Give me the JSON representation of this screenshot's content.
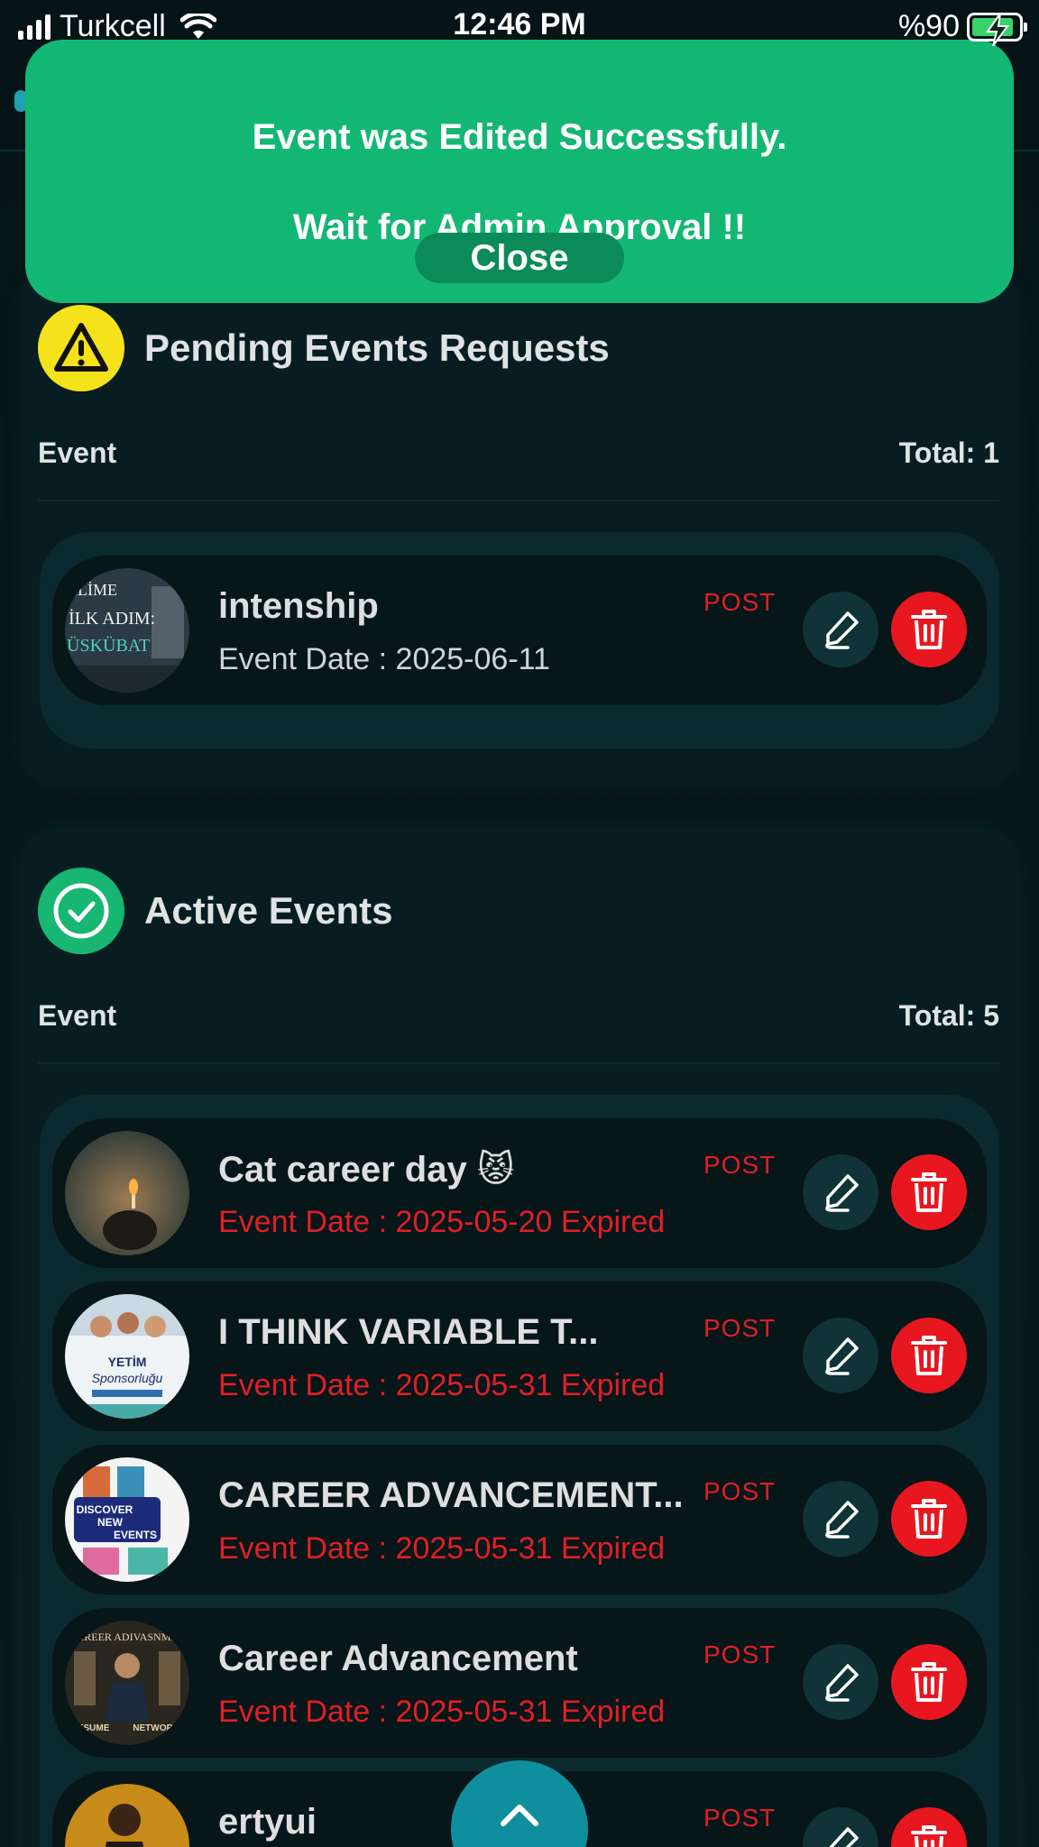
{
  "status_bar": {
    "carrier": "Turkcell",
    "time": "12:46 PM",
    "battery": "%90"
  },
  "toast": {
    "line1": "Event was Edited Successfully.",
    "line2": "Wait for Admin Approval !!",
    "close_label": "Close"
  },
  "pending": {
    "title": "Pending Events Requests",
    "column_label": "Event",
    "total": "Total: 1",
    "items": [
      {
        "title": "intenship",
        "date": "Event Date : 2025-06-11",
        "tag": "POST",
        "expired": false
      }
    ]
  },
  "active": {
    "title": "Active Events",
    "column_label": "Event",
    "total": "Total: 5",
    "items": [
      {
        "title": "Cat career day 😾",
        "date": "Event Date : 2025-05-20 Expired",
        "tag": "POST",
        "expired": true
      },
      {
        "title": "I THINK VARIABLE T...",
        "date": "Event Date : 2025-05-31 Expired",
        "tag": "POST",
        "expired": true
      },
      {
        "title": "CAREER ADVANCEMENT...",
        "date": "Event Date : 2025-05-31 Expired",
        "tag": "POST",
        "expired": true
      },
      {
        "title": "Career Advancement",
        "date": "Event Date : 2025-05-31 Expired",
        "tag": "POST",
        "expired": true
      },
      {
        "title": "ertyui",
        "date": "",
        "tag": "POST",
        "expired": true
      }
    ]
  },
  "thumb_text": {
    "pending_0": [
      "İLİME",
      "İLK ADIM:",
      "ÜSKÜBAT"
    ],
    "active_1": [
      "YETİM",
      "Sponsorluğu"
    ],
    "active_2": [
      "DISCOVER",
      "NEW",
      "EVENTS"
    ],
    "active_3": [
      "CAREER ADIVASNMEN",
      "RESUME",
      "NETWORKING"
    ]
  },
  "colors": {
    "toast_bg": "#13b774",
    "pending_icon": "#f6e21a",
    "active_icon": "#17b673",
    "delete": "#e8171f",
    "expired": "#e11f25"
  },
  "icons": {
    "pending": "warning-icon",
    "active": "check-circle-icon",
    "edit": "pencil-icon",
    "delete": "trash-icon",
    "fab": "chevron-up-icon"
  }
}
